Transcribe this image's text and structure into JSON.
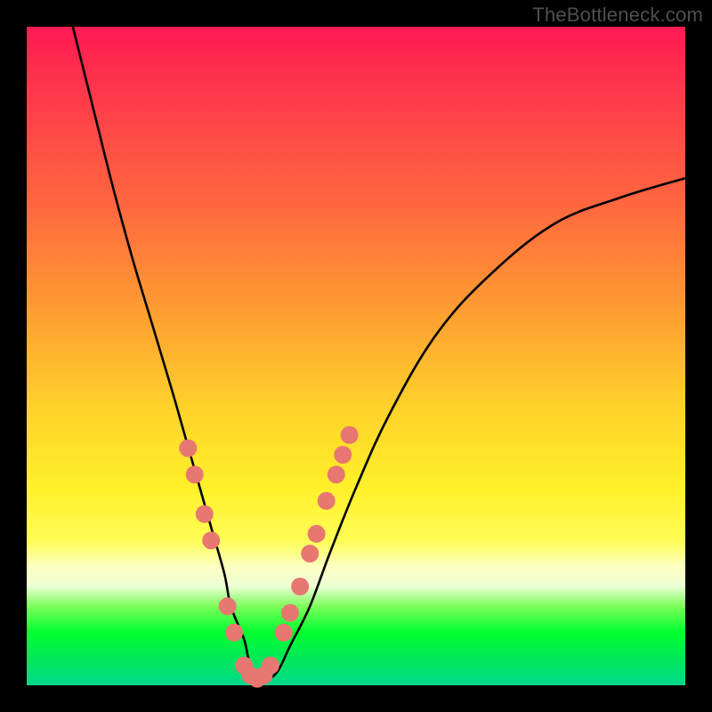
{
  "watermark": "TheBottleneck.com",
  "chart_data": {
    "type": "line",
    "title": "",
    "xlabel": "",
    "ylabel": "",
    "xlim": [
      0,
      100
    ],
    "ylim": [
      0,
      100
    ],
    "grid": false,
    "legend": false,
    "series": [
      {
        "name": "bottleneck-curve",
        "color": "#000000",
        "x": [
          7,
          10,
          13,
          16,
          19,
          22,
          24,
          26,
          28,
          30,
          31,
          33,
          34,
          36,
          38,
          40,
          43,
          46,
          50,
          55,
          62,
          70,
          80,
          90,
          100
        ],
        "y": [
          100,
          88,
          76,
          65,
          55,
          45,
          38,
          31,
          24,
          17,
          12,
          7,
          3,
          1,
          2,
          6,
          12,
          20,
          30,
          41,
          53,
          62,
          70,
          74,
          77
        ]
      }
    ],
    "markers": {
      "name": "highlight-dots",
      "color": "#e77770",
      "radius": 10,
      "points": [
        {
          "x": 24.5,
          "y": 36
        },
        {
          "x": 25.5,
          "y": 32
        },
        {
          "x": 27.0,
          "y": 26
        },
        {
          "x": 28.0,
          "y": 22
        },
        {
          "x": 30.5,
          "y": 12
        },
        {
          "x": 31.5,
          "y": 8
        },
        {
          "x": 33.0,
          "y": 3
        },
        {
          "x": 34.0,
          "y": 1.5
        },
        {
          "x": 35.0,
          "y": 1
        },
        {
          "x": 36.0,
          "y": 1.5
        },
        {
          "x": 37.0,
          "y": 3
        },
        {
          "x": 39.0,
          "y": 8
        },
        {
          "x": 40.0,
          "y": 11
        },
        {
          "x": 41.5,
          "y": 15
        },
        {
          "x": 43.0,
          "y": 20
        },
        {
          "x": 44.0,
          "y": 23
        },
        {
          "x": 45.5,
          "y": 28
        },
        {
          "x": 47.0,
          "y": 32
        },
        {
          "x": 48.0,
          "y": 35
        },
        {
          "x": 49.0,
          "y": 38
        }
      ]
    }
  }
}
